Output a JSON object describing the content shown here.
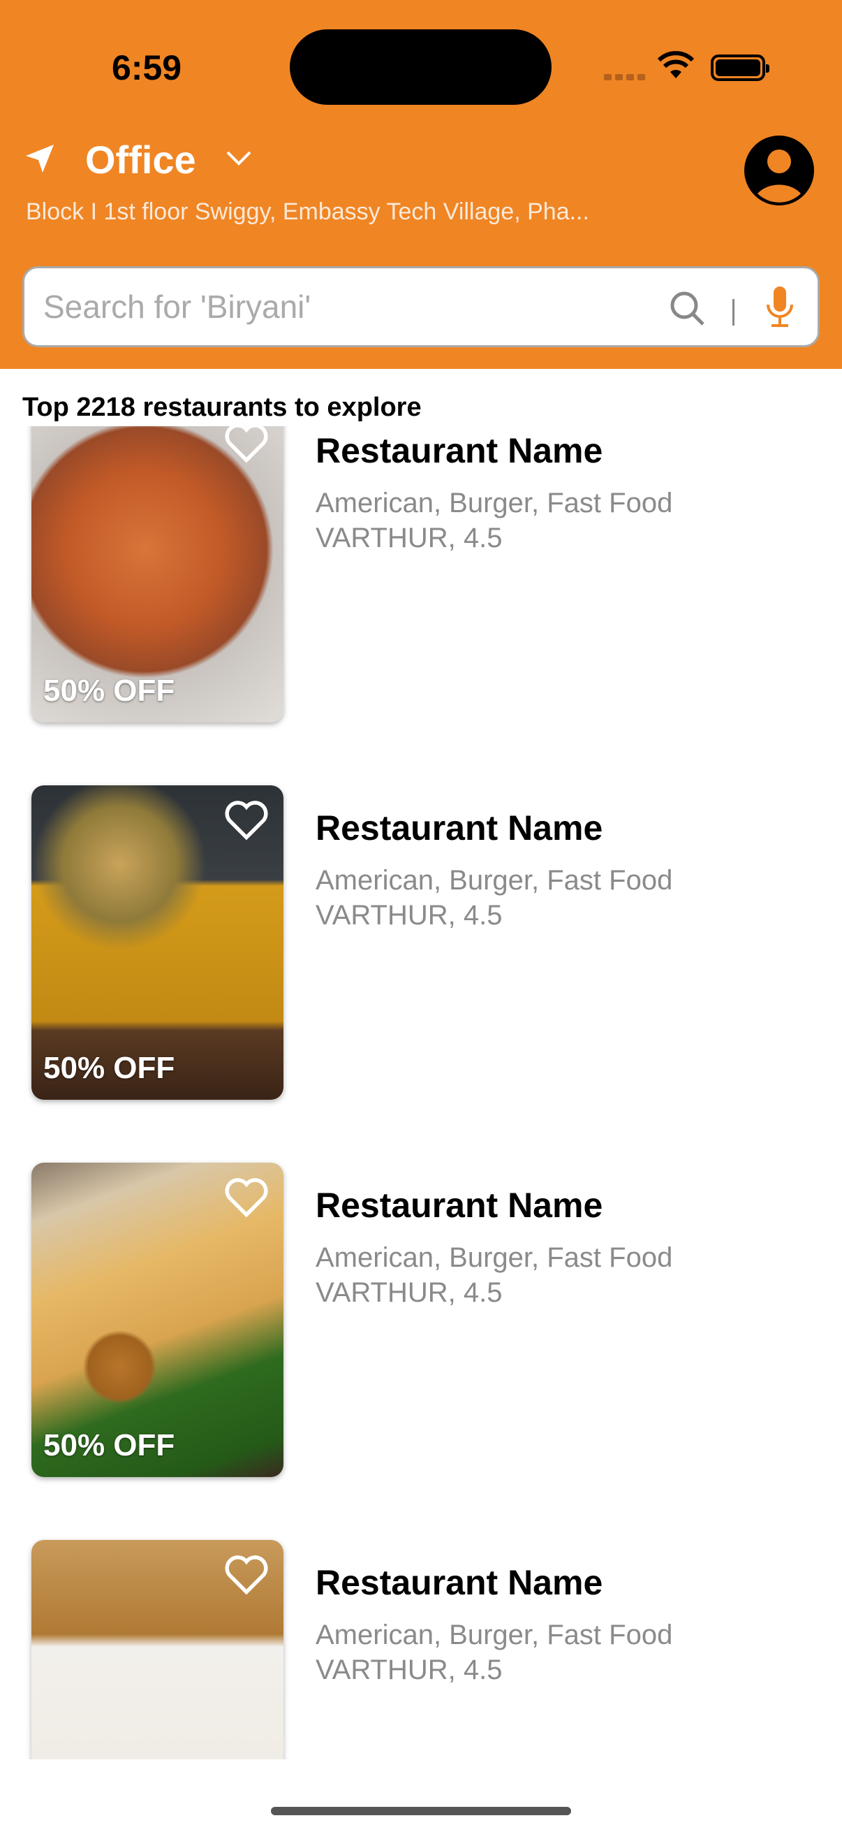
{
  "status_bar": {
    "time": "6:59"
  },
  "header": {
    "location_label": "Office",
    "address": "Block I 1st floor Swiggy, Embassy Tech Village, Pha...",
    "brand_color": "#F08524"
  },
  "search": {
    "placeholder": "Search for 'Biryani'",
    "value": ""
  },
  "list_title": "Top 2218 restaurants to explore",
  "restaurants": [
    {
      "name": "Restaurant Name",
      "cuisines": "American, Burger, Fast Food",
      "location_rating": "VARTHUR, 4.5",
      "offer": "50% OFF",
      "image": "biryani"
    },
    {
      "name": "Restaurant Name",
      "cuisines": "American, Burger, Fast Food",
      "location_rating": "VARTHUR, 4.5",
      "offer": "50% OFF",
      "image": "chinese-wok-noodles"
    },
    {
      "name": "Restaurant Name",
      "cuisines": "American, Burger, Fast Food",
      "location_rating": "VARTHUR, 4.5",
      "offer": "50% OFF",
      "image": "dosa-vada"
    },
    {
      "name": "Restaurant Name",
      "cuisines": "American, Burger, Fast Food",
      "location_rating": "VARTHUR, 4.5",
      "offer": "",
      "image": "pvr-popcorn"
    }
  ]
}
